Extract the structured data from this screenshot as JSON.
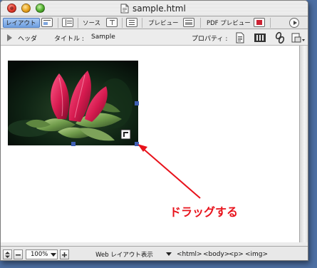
{
  "window": {
    "title": "sample.html"
  },
  "tabs": [
    {
      "label": "レイアウト",
      "active": true
    },
    {
      "label": "ソース",
      "active": false
    },
    {
      "label": "プレビュー",
      "active": false
    },
    {
      "label": "PDF プレビュー",
      "active": false
    }
  ],
  "toolbar": {
    "header_label": "ヘッダ",
    "title_label": "タイトル :",
    "title_value": "Sample",
    "properties_label": "プロパティ :"
  },
  "annotation": {
    "text": "ドラッグする",
    "color": "#e8121b"
  },
  "statusbar": {
    "zoom": "100%",
    "view_mode": "Web レイアウト表示",
    "breadcrumb": [
      "<html>",
      "<body>",
      "<p>",
      "<img>"
    ]
  },
  "icons": {
    "doc": "document-icon",
    "properties": [
      "page-icon",
      "film-icon",
      "link-icon",
      "object-icon"
    ]
  },
  "colors": {
    "accent_tab": "#6f9fe0",
    "selection_handle": "#3f5fb2",
    "desktop": "#4d6fa3"
  }
}
